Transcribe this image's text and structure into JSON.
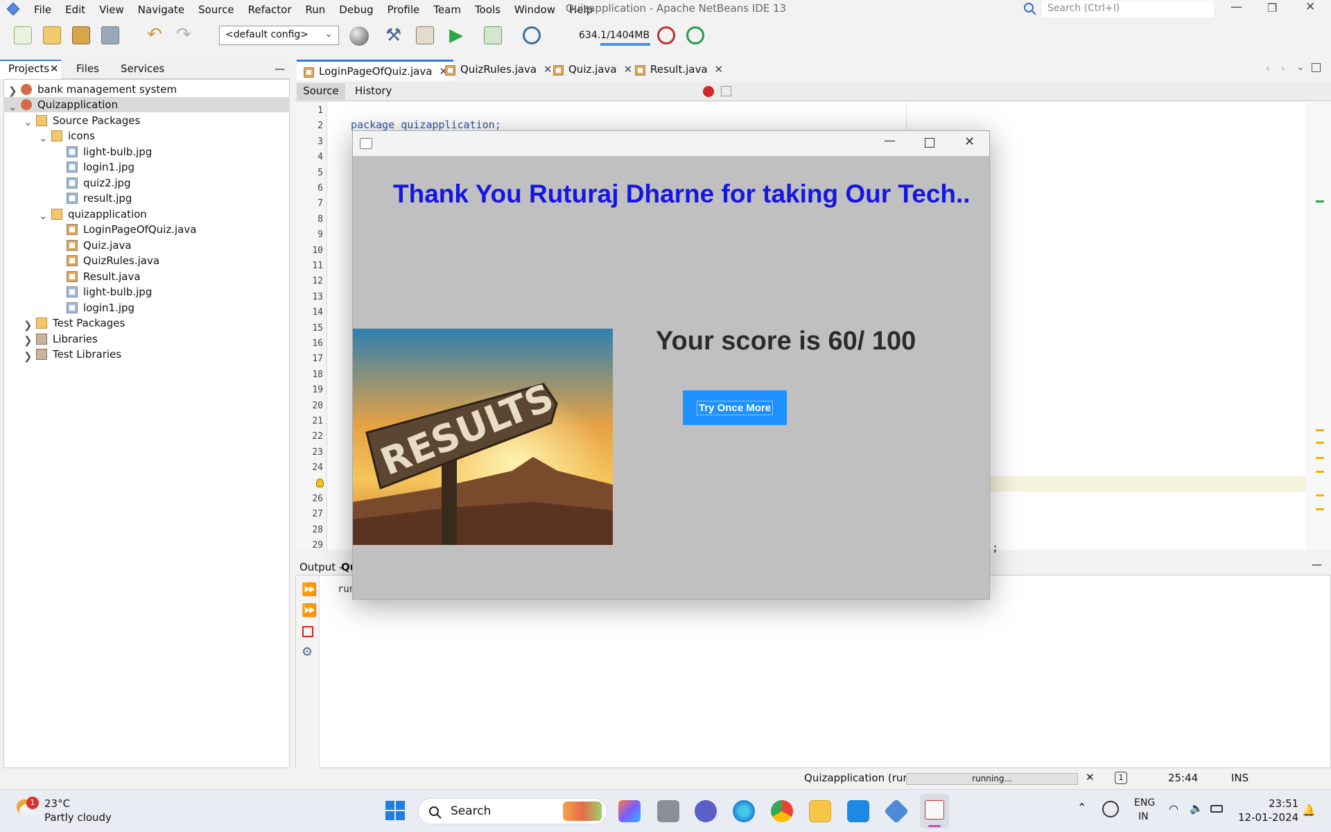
{
  "app": {
    "title": "Quizapplication - Apache NetBeans IDE 13",
    "menu": [
      "File",
      "Edit",
      "View",
      "Navigate",
      "Source",
      "Refactor",
      "Run",
      "Debug",
      "Profile",
      "Team",
      "Tools",
      "Window",
      "Help"
    ],
    "search_placeholder": "Search (Ctrl+I)"
  },
  "toolbar": {
    "config": "<default config>",
    "memory": "634.1/1404MB"
  },
  "projects_panel": {
    "tabs": [
      "Projects",
      "Files",
      "Services"
    ],
    "tree": [
      {
        "label": "bank management system",
        "level": 0,
        "icon": "project-icon"
      },
      {
        "label": "Quizapplication",
        "level": 0,
        "icon": "project-icon",
        "selected": true
      },
      {
        "label": "Source Packages",
        "level": 1,
        "icon": "source-packages-icon"
      },
      {
        "label": "icons",
        "level": 2,
        "icon": "package-icon"
      },
      {
        "label": "light-bulb.jpg",
        "level": 3,
        "icon": "image-file-icon"
      },
      {
        "label": "login1.jpg",
        "level": 3,
        "icon": "image-file-icon"
      },
      {
        "label": "quiz2.jpg",
        "level": 3,
        "icon": "image-file-icon"
      },
      {
        "label": "result.jpg",
        "level": 3,
        "icon": "image-file-icon"
      },
      {
        "label": "quizapplication",
        "level": 2,
        "icon": "package-icon"
      },
      {
        "label": "LoginPageOfQuiz.java",
        "level": 3,
        "icon": "java-file-icon"
      },
      {
        "label": "Quiz.java",
        "level": 3,
        "icon": "java-file-icon"
      },
      {
        "label": "QuizRules.java",
        "level": 3,
        "icon": "java-file-icon"
      },
      {
        "label": "Result.java",
        "level": 3,
        "icon": "java-file-icon"
      },
      {
        "label": "light-bulb.jpg",
        "level": 3,
        "icon": "image-file-icon"
      },
      {
        "label": "login1.jpg",
        "level": 3,
        "icon": "image-file-icon"
      },
      {
        "label": "Test Packages",
        "level": 1,
        "icon": "test-packages-icon"
      },
      {
        "label": "Libraries",
        "level": 1,
        "icon": "libraries-icon"
      },
      {
        "label": "Test Libraries",
        "level": 1,
        "icon": "libraries-icon"
      }
    ]
  },
  "editor": {
    "tabs": [
      "LoginPageOfQuiz.java",
      "QuizRules.java",
      "Quiz.java",
      "Result.java"
    ],
    "source_tab": "Source",
    "history_tab": "History",
    "line_numbers": [
      "1",
      "2",
      "3",
      "4",
      "5",
      "6",
      "7",
      "8",
      "9",
      "10",
      "11",
      "12",
      "13",
      "14",
      "15",
      "16",
      "17",
      "18",
      "19",
      "20",
      "21",
      "22",
      "23",
      "24",
      "",
      "26",
      "27",
      "28",
      "29"
    ],
    "code_line_2": "package quizapplication;",
    "code_fragment": ");"
  },
  "output": {
    "title_prefix": "Output - ",
    "title_fragment": "Qu",
    "text_fragment": "run"
  },
  "status": {
    "project": "Quizapplication (run)",
    "progress_label": "running...",
    "notifications": "1",
    "position": "25:44",
    "mode": "INS"
  },
  "result_window": {
    "thank_you": "Thank You Ruturaj Dharne for taking Our Tech..",
    "score": "Your score is 60/ 100",
    "button": "Try Once More",
    "image_text": "RESULTS"
  },
  "taskbar": {
    "weather_temp": "23°C",
    "weather_desc": "Partly cloudy",
    "weather_badge": "1",
    "search": "Search",
    "lang_top": "ENG",
    "lang_bottom": "IN",
    "time": "23:51",
    "date": "12-01-2024"
  }
}
